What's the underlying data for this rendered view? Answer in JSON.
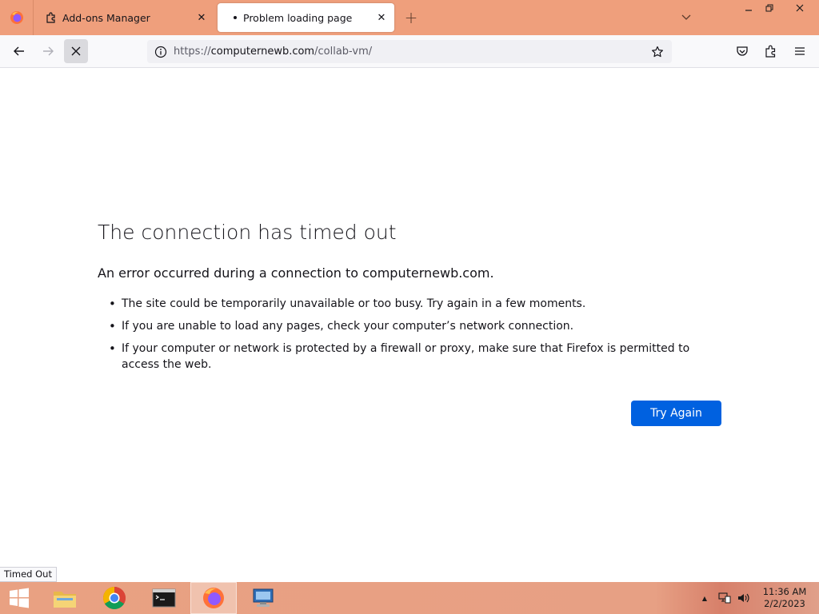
{
  "browser": {
    "tabs": [
      {
        "label": "Add-ons Manager",
        "icon": "puzzle-icon",
        "active": false
      },
      {
        "label": "Problem loading page",
        "icon": "loading-dot",
        "active": true
      }
    ],
    "url": {
      "protocol": "https://",
      "host": "computernewb.com",
      "path": "/collab-vm/"
    },
    "status_text": "Timed Out"
  },
  "error_page": {
    "title": "The connection has timed out",
    "description": "An error occurred during a connection to computernewb.com.",
    "bullets": [
      "The site could be temporarily unavailable or too busy. Try again in a few moments.",
      "If you are unable to load any pages, check your computer’s network connection.",
      "If your computer or network is protected by a firewall or proxy, make sure that Firefox is permitted to access the web."
    ],
    "button_label": "Try Again"
  },
  "taskbar": {
    "apps": [
      "file-explorer-icon",
      "chrome-icon",
      "command-prompt-icon",
      "firefox-icon",
      "remote-desktop-icon"
    ],
    "time": "11:36 AM",
    "date": "2/2/2023"
  },
  "colors": {
    "tabstrip": "#ef9f7c",
    "primary_button": "#0061e0",
    "taskbar": "#e9a182"
  }
}
